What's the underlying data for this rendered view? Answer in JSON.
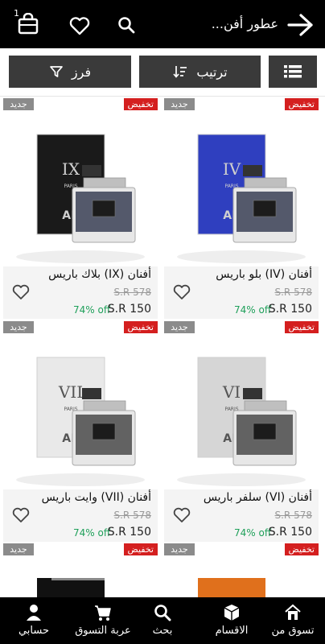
{
  "header": {
    "title": "عطور أفن...",
    "cart_count": "1",
    "icons": [
      "cart-icon",
      "heart-icon",
      "search-icon",
      "back-arrow-icon"
    ]
  },
  "toolbar": {
    "filter_label": "فرز",
    "sort_label": "ترتيب",
    "view_icon": "list-view-icon"
  },
  "products": [
    {
      "name": "أفنان (IV) بلو باريس",
      "old_price": "S.R 578",
      "price": "S.R 150",
      "discount": "74% off",
      "badge_sale": "تخفيض",
      "badge_new": "جديد",
      "box_color": "#2f3fbf",
      "box_label": "IV"
    },
    {
      "name": "أفنان (IX) بلاك باريس",
      "old_price": "S.R 578",
      "price": "S.R 150",
      "discount": "74% off",
      "badge_sale": "تخفيض",
      "badge_new": "جديد",
      "box_color": "#1a1a1a",
      "box_label": "IX"
    },
    {
      "name": "أفنان (VI) سلفر باريس",
      "old_price": "S.R 578",
      "price": "S.R 150",
      "discount": "74% off",
      "badge_sale": "تخفيض",
      "badge_new": "جديد",
      "box_color": "#d6d6d6",
      "box_label": "VI"
    },
    {
      "name": "أفنان (VII) وايت باريس",
      "old_price": "S.R 578",
      "price": "S.R 150",
      "discount": "74% off",
      "badge_sale": "تخفيض",
      "badge_new": "جديد",
      "box_color": "#e9e9e9",
      "box_label": "VII"
    }
  ],
  "partial_row": {
    "badge_sale": "تخفيض",
    "badge_new": "جديد"
  },
  "bottom_nav": [
    {
      "label": "تسوق من",
      "icon": "home-icon"
    },
    {
      "label": "الاقسام",
      "icon": "categories-icon"
    },
    {
      "label": "بحث",
      "icon": "search-icon"
    },
    {
      "label": "عربة التسوق",
      "icon": "shopping-cart-icon"
    },
    {
      "label": "حسابي",
      "icon": "account-icon"
    }
  ],
  "colors": {
    "bar": "#000000",
    "button": "#3a3a3a",
    "sale_badge": "#d41f1f",
    "new_badge": "#8b8b8b",
    "discount": "#1fa05a"
  }
}
